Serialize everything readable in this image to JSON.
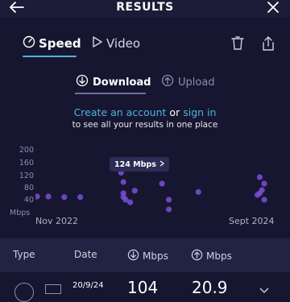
{
  "header": {
    "title": "RESULTS",
    "back_icon": "arrow-left-icon",
    "close_icon": "close-icon"
  },
  "tabs": {
    "speed_label": "Speed",
    "video_label": "Video",
    "speed_icon": "gauge-icon",
    "video_icon": "play-icon",
    "delete_icon": "trash-icon",
    "share_icon": "share-icon"
  },
  "subtabs": {
    "download_label": "Download",
    "upload_label": "Upload"
  },
  "promo": {
    "create_account": "Create an account",
    "or": "or",
    "sign_in": "sign in",
    "line2": "to see all your results in one place"
  },
  "chart_data": {
    "type": "scatter",
    "y_ticks": [
      "200",
      "160",
      "120",
      "80",
      "40"
    ],
    "y_unit": "Mbps",
    "x_labels": [
      "Nov 2022",
      "Sept 2024"
    ],
    "ylim": [
      0,
      200
    ],
    "tooltip": "124 Mbps",
    "points_x_fraction": [
      0.0,
      0.05,
      0.12,
      0.19,
      0.37,
      0.38,
      0.38,
      0.38,
      0.39,
      0.41,
      0.43,
      0.55,
      0.58,
      0.71,
      0.98,
      1.0,
      0.99,
      0.97,
      1.0,
      0.98,
      0.58
    ],
    "points_y_mbps": [
      50,
      50,
      48,
      48,
      124,
      95,
      60,
      48,
      40,
      32,
      68,
      90,
      40,
      64,
      110,
      90,
      70,
      55,
      40,
      60,
      10
    ],
    "color": "#7b4fd6"
  },
  "table": {
    "col_type": "Type",
    "col_date": "Date",
    "col_down": "Mbps",
    "col_up": "Mbps",
    "first_row_date": "20/9/24",
    "first_row_down": "104",
    "first_row_up": "20.9"
  },
  "colors": {
    "accent": "#4fb3d9",
    "background": "#161630",
    "point": "#7b4fd6"
  }
}
